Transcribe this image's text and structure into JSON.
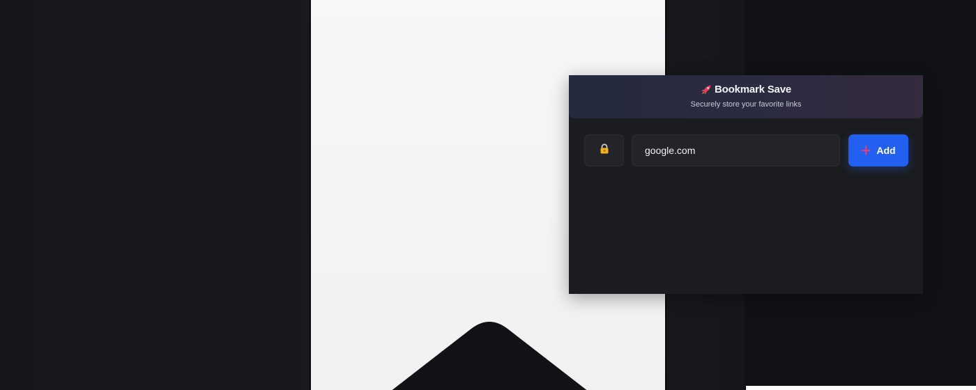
{
  "popup": {
    "title": "Bookmark Save",
    "subtitle": "Securely store your favorite links",
    "title_icon": "rocket-icon",
    "lock_icon": "lock-icon",
    "url_value": "google.com",
    "add_label": "Add",
    "add_icon": "plus-icon"
  },
  "colors": {
    "accent": "#2160f0",
    "popup_bg": "#1b1c20",
    "header_gradient_start": "#252a3e",
    "header_gradient_end": "#352a3e",
    "lock": "#f2b01e",
    "plus": "#e0407a"
  }
}
